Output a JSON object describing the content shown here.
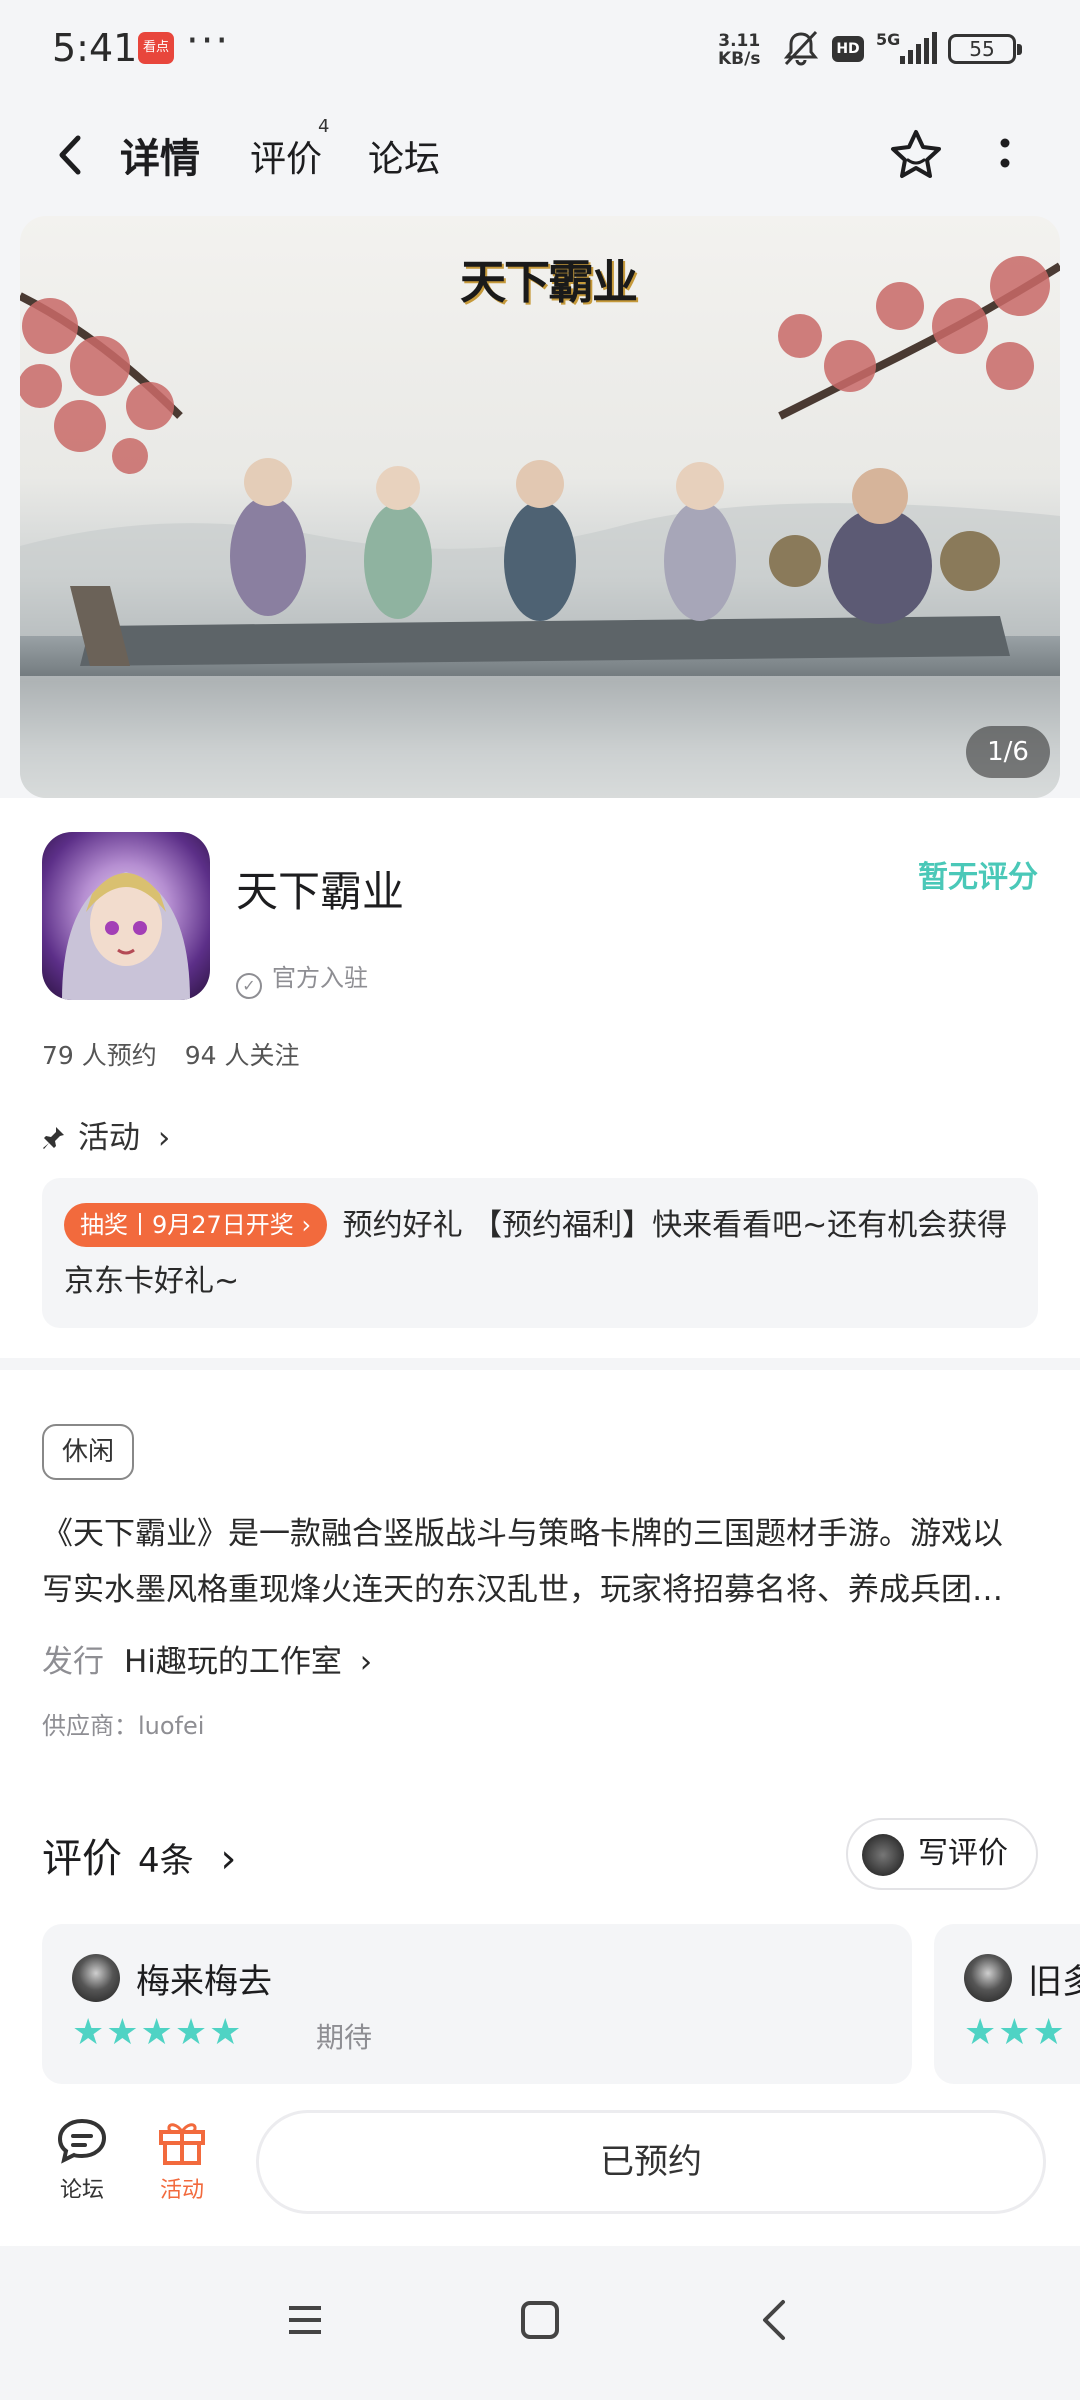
{
  "status_bar": {
    "time": "5:41",
    "app_badge": "看点",
    "net_speed_value": "3.11",
    "net_speed_unit": "KB/s",
    "battery": "55",
    "hd_label": "HD",
    "network": "5G"
  },
  "nav": {
    "tabs": [
      {
        "label": "详情"
      },
      {
        "label": "评价",
        "sup": "4"
      },
      {
        "label": "论坛"
      }
    ]
  },
  "banner": {
    "art_title": "天下霸业",
    "counter": "1/6"
  },
  "app": {
    "name": "天下霸业",
    "official": "官方入驻",
    "rating": "暂无评分",
    "reservations": "79 人预约",
    "follows": "94 人关注"
  },
  "activity": {
    "header": "活动",
    "tag": "抽奖丨9月27日开奖",
    "text": "预约好礼 【预约福利】快来看看吧~还有机会获得京东卡好礼~"
  },
  "detail": {
    "genre": "休闲",
    "description_line1": "《天下霸业》是一款融合竖版战斗与策略卡牌的三国题材手游。游戏以",
    "description_line2": "写实水墨风格重现烽火连天的东汉乱世，玩家将招募名将、养成兵团…",
    "publisher_label": "发行",
    "publisher": "Hi趣玩的工作室",
    "supplier": "供应商：luofei"
  },
  "reviews": {
    "title": "评价",
    "count": "4条",
    "write_label": "写评价",
    "items": [
      {
        "user": "梅来梅去",
        "stars": "★★★★★",
        "mood": "期待"
      },
      {
        "user": "旧多",
        "stars": "★★★",
        "mood": ""
      }
    ]
  },
  "bottom_bar": {
    "forum_label": "论坛",
    "activity_label": "活动",
    "reserved_label": "已预约"
  },
  "colors": {
    "accent": "#4fd3c4",
    "orange": "#f26a3d"
  }
}
